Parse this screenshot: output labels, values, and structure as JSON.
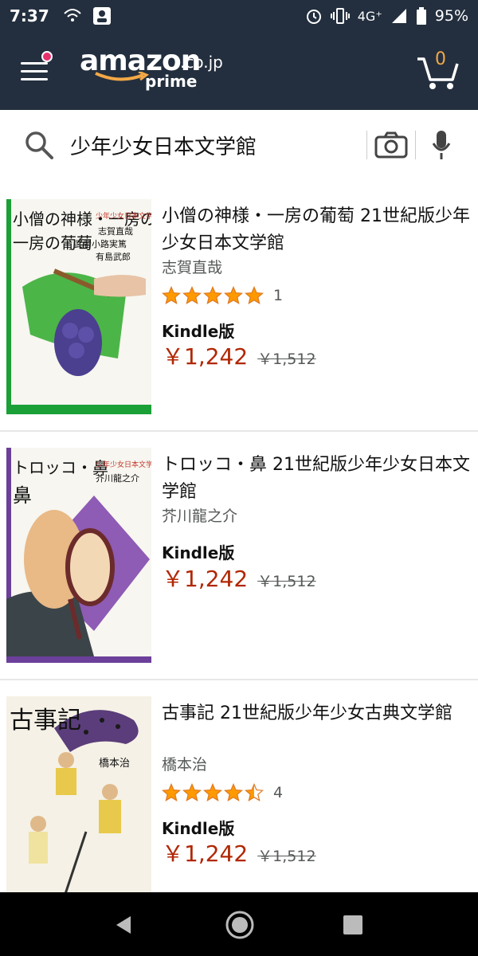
{
  "status_bar": {
    "time": "7:37",
    "network": "4G⁺",
    "battery": "95%"
  },
  "header": {
    "logo_main": "amazon",
    "logo_tld": ".co.jp",
    "logo_sub": "prime",
    "cart_count": "0"
  },
  "search": {
    "query": "少年少女日本文学館"
  },
  "results": [
    {
      "title": "小僧の神様・一房の葡萄 21世紀版少年少女日本文学館",
      "author": "志賀直哉",
      "rating": 5,
      "review_count": "1",
      "format": "Kindle版",
      "price": "￥1,242",
      "list_price": "￥1,512",
      "cover": {
        "title_text": "小僧の神様・一房の葡萄",
        "series": "少年少女日本文学館",
        "authors": [
          "志賀直哉",
          "武者小路実篤",
          "有島武郎"
        ],
        "accent": "#1aa037"
      }
    },
    {
      "title": "トロッコ・鼻 21世紀版少年少女日本文学館",
      "author": "芥川龍之介",
      "format": "Kindle版",
      "price": "￥1,242",
      "list_price": "￥1,512",
      "cover": {
        "title_text": "トロッコ・鼻",
        "series": "少年少女日本文学館",
        "authors": [
          "芥川龍之介"
        ],
        "accent": "#6b3f9a"
      }
    },
    {
      "title": "古事記 21世紀版少年少女古典文学館",
      "author": "橋本治",
      "rating": 4.5,
      "review_count": "4",
      "format": "Kindle版",
      "price": "￥1,242",
      "list_price": "￥1,512",
      "cover": {
        "title_text": "古事記",
        "authors": [
          "橋本治"
        ],
        "accent": "#c0392b"
      }
    }
  ],
  "colors": {
    "header_bg": "#232f3e",
    "price": "#b12704",
    "star": "#ff9900",
    "cart_count": "#f3a847"
  }
}
